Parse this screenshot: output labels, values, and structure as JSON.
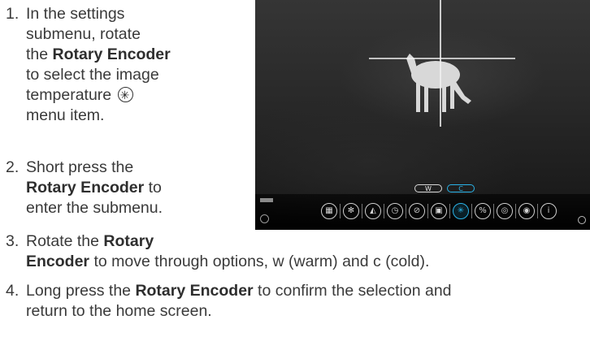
{
  "steps": [
    {
      "number": "1.",
      "lines": [
        [
          {
            "t": "In the settings"
          }
        ],
        [
          {
            "t": "submenu, rotate"
          }
        ],
        [
          {
            "t": "the "
          },
          {
            "t": "Rotary Encoder",
            "b": true
          }
        ],
        [
          {
            "t": "to select the image"
          }
        ],
        [
          {
            "t": "temperature "
          },
          {
            "icon": "snowflake-icon"
          }
        ],
        [
          {
            "t": "menu item."
          }
        ]
      ]
    },
    {
      "number": "2.",
      "lines": [
        [
          {
            "t": "Short press the"
          }
        ],
        [
          {
            "t": "Rotary Encoder",
            "b": true
          },
          {
            "t": " to"
          }
        ],
        [
          {
            "t": "enter the submenu."
          }
        ]
      ]
    },
    {
      "number": "3.",
      "lines": [
        [
          {
            "t": "Rotate the "
          },
          {
            "t": "Rotary",
            "b": true
          }
        ],
        [
          {
            "t": "Encoder",
            "b": true
          },
          {
            "t": " to move through options, w (warm) and c (cold)."
          }
        ]
      ]
    },
    {
      "number": "4.",
      "lines": [
        [
          {
            "t": "Long press the "
          },
          {
            "t": "Rotary Encoder",
            "b": true
          },
          {
            "t": " to confirm the selection and"
          }
        ],
        [
          {
            "t": "return to the home screen."
          }
        ]
      ]
    }
  ],
  "device_screen": {
    "toggle_w": "W",
    "toggle_c": "C",
    "accent": "#2ab3e8",
    "menu_icons": [
      "grid-icon",
      "bluetooth-icon",
      "mountain-icon",
      "clock-icon",
      "compass-icon",
      "display-icon",
      "snowflake-icon",
      "percent-icon",
      "aperture-icon",
      "ring-icon",
      "info-icon"
    ],
    "menu_glyphs": [
      "▦",
      "✻",
      "◭",
      "◷",
      "⊘",
      "▣",
      "✳",
      "%",
      "◎",
      "◉",
      "i"
    ],
    "selected_index": 6
  }
}
